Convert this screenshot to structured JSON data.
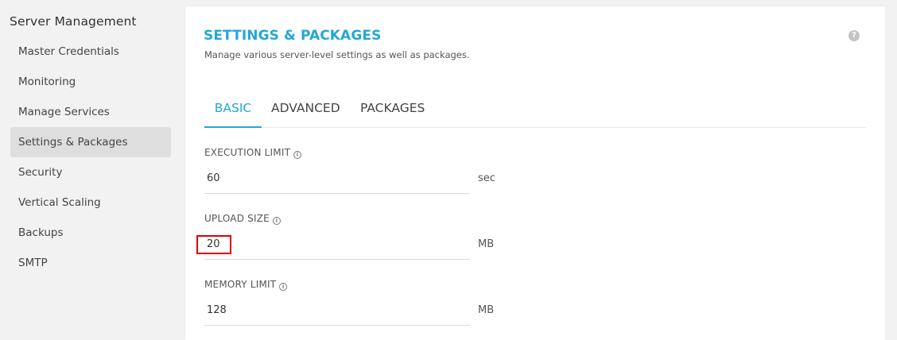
{
  "sidebar": {
    "title": "Server Management",
    "items": [
      {
        "label": "Master Credentials"
      },
      {
        "label": "Monitoring"
      },
      {
        "label": "Manage Services"
      },
      {
        "label": "Settings & Packages"
      },
      {
        "label": "Security"
      },
      {
        "label": "Vertical Scaling"
      },
      {
        "label": "Backups"
      },
      {
        "label": "SMTP"
      }
    ],
    "active_item": "Settings & Packages"
  },
  "panel": {
    "title": "SETTINGS & PACKAGES",
    "subtitle": "Manage various server-level settings as well as packages.",
    "help_icon": "?"
  },
  "tabs": [
    {
      "label": "BASIC",
      "active": true
    },
    {
      "label": "ADVANCED",
      "active": false
    },
    {
      "label": "PACKAGES",
      "active": false
    }
  ],
  "fields": {
    "execution_limit": {
      "label": "EXECUTION LIMIT",
      "value": "60",
      "unit": "sec"
    },
    "upload_size": {
      "label": "UPLOAD SIZE",
      "value": "20",
      "unit": "MB"
    },
    "memory_limit": {
      "label": "MEMORY LIMIT",
      "value": "128",
      "unit": "MB"
    }
  },
  "colors": {
    "accent": "#22a7d6",
    "highlight": "#e00000"
  }
}
